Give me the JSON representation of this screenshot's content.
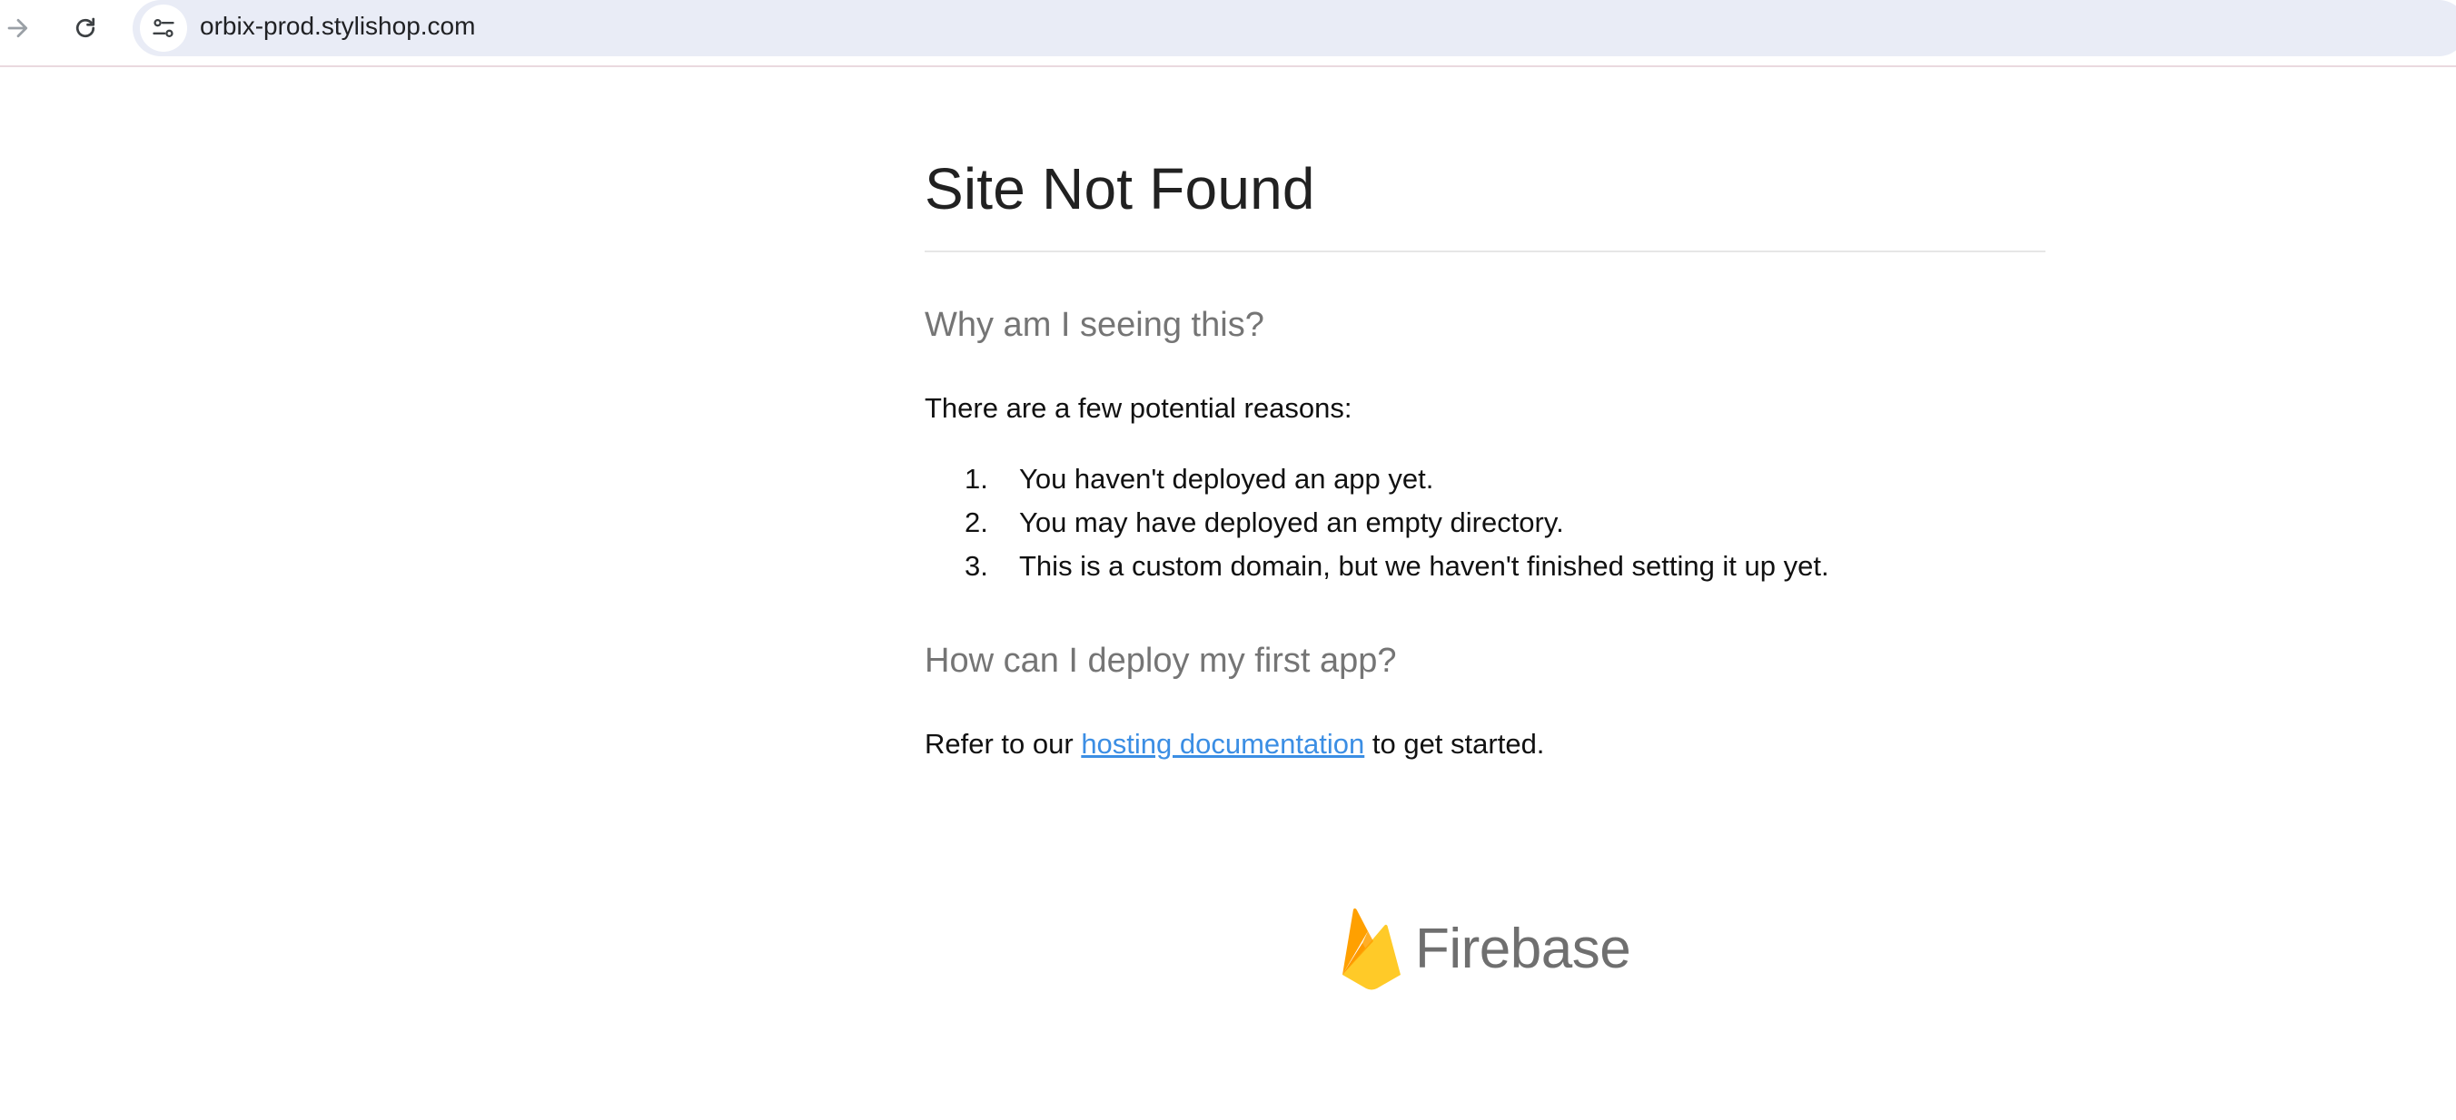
{
  "browser": {
    "url": "orbix-prod.stylishop.com",
    "icons": {
      "forward": "arrow-right-icon",
      "reload": "reload-icon",
      "site_info": "tune-icon"
    }
  },
  "page": {
    "title": "Site Not Found",
    "why_heading": "Why am I seeing this?",
    "intro": "There are a few potential reasons:",
    "reasons": [
      {
        "num": "1.",
        "text": "You haven't deployed an app yet."
      },
      {
        "num": "2.",
        "text": "You may have deployed an empty directory."
      },
      {
        "num": "3.",
        "text": "This is a custom domain, but we haven't finished setting it up yet."
      }
    ],
    "how_heading": "How can I deploy my first app?",
    "refer_prefix": "Refer to our ",
    "refer_link": "hosting documentation",
    "refer_suffix": " to get started."
  },
  "logo": {
    "wordmark": "Firebase",
    "icon": "firebase-flame-icon"
  },
  "colors": {
    "heading": "#212121",
    "subheading": "#757575",
    "link": "#3b8ee4",
    "omnibox": "#e9ecf6"
  }
}
